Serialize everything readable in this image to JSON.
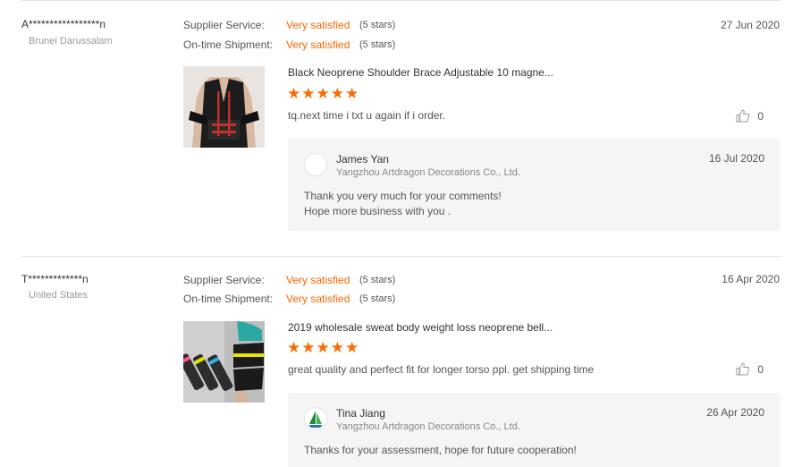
{
  "reviews": [
    {
      "buyer": "A*****************n",
      "country": "Brunei Darussalam",
      "supplier_label": "Supplier Service:",
      "supplier_value": "Very satisfied",
      "supplier_stars": "(5 stars)",
      "shipment_label": "On-time Shipment:",
      "shipment_value": "Very satisfied",
      "shipment_stars": "(5 stars)",
      "date": "27 Jun 2020",
      "product_title": "Black Neoprene Shoulder Brace Adjustable 10 magne...",
      "rating": 5,
      "text": "tq.next time i txt u again if i order.",
      "likes": "0",
      "reply": {
        "name": "James Yan",
        "company": "Yangzhou Artdragon Decorations Co., Ltd.",
        "date": "16 Jul 2020",
        "line1": "Thank you very much for your comments!",
        "line2": "Hope more business with you ."
      }
    },
    {
      "buyer": "T*************n",
      "country": "United States",
      "supplier_label": "Supplier Service:",
      "supplier_value": "Very satisfied",
      "supplier_stars": "(5 stars)",
      "shipment_label": "On-time Shipment:",
      "shipment_value": "Very satisfied",
      "shipment_stars": "(5 stars)",
      "date": "16 Apr 2020",
      "product_title": "2019 wholesale sweat body weight loss neoprene bell...",
      "rating": 5,
      "text": "great quality and perfect fit for longer torso ppl. get shipping time",
      "likes": "0",
      "reply": {
        "name": "Tina Jiang",
        "company": "Yangzhou Artdragon Decorations Co., Ltd.",
        "date": "26 Apr 2020",
        "line1": "Thanks for your assessment, hope for future cooperation!"
      }
    }
  ],
  "colors": {
    "accent": "#ff6600",
    "star": "#ff6a00",
    "reply_bg": "#f5f5f5"
  },
  "icons": {
    "like": "thumbs-up-icon",
    "star": "star-icon"
  }
}
